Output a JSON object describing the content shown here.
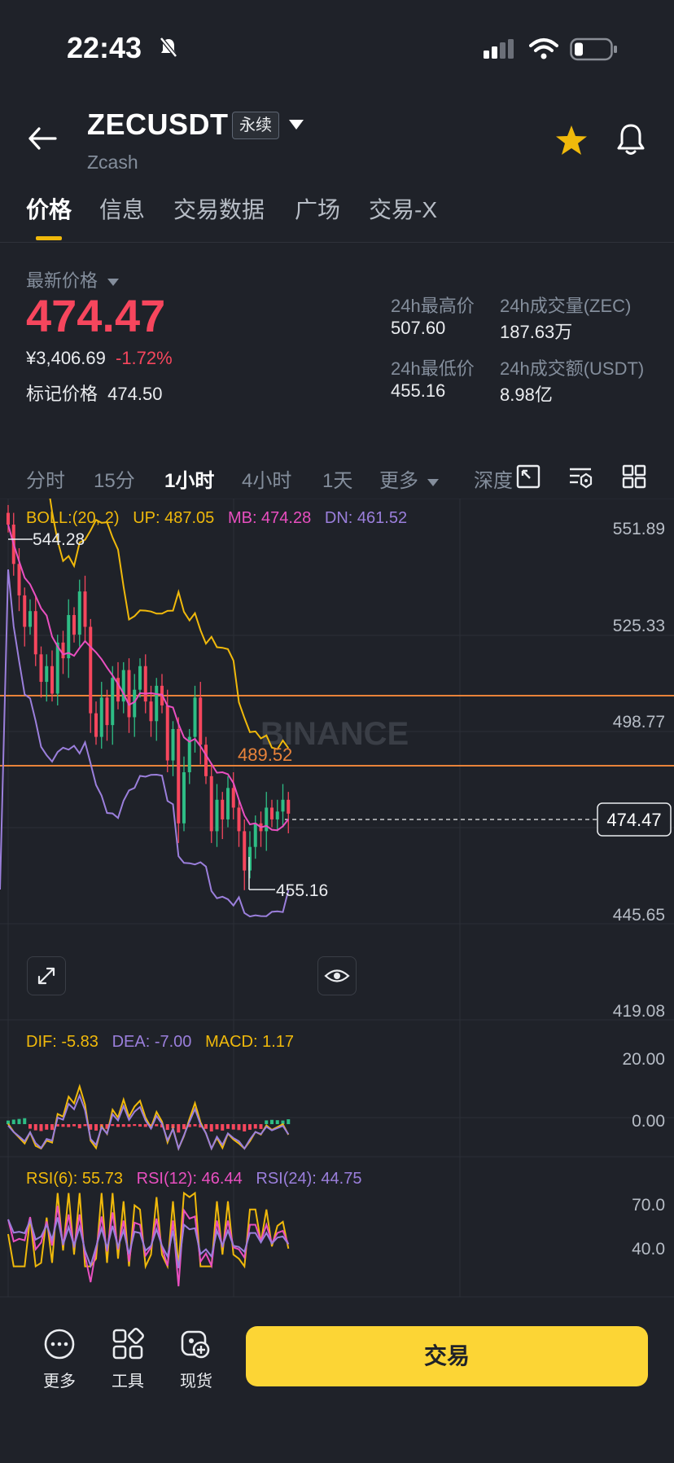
{
  "status_bar": {
    "time": "22:43"
  },
  "header": {
    "symbol": "ZECUSDT",
    "contract_type": "永续",
    "coin_name": "Zcash"
  },
  "tabs": [
    "价格",
    "信息",
    "交易数据",
    "广场",
    "交易-X"
  ],
  "price": {
    "latest_label": "最新价格",
    "last": "474.47",
    "cny": "¥3,406.69",
    "change": "-1.72%",
    "mark_label": "标记价格",
    "mark_value": "474.50",
    "stats": [
      {
        "label": "24h最高价",
        "value": "507.60"
      },
      {
        "label": "24h成交量(ZEC)",
        "value": "187.63万"
      },
      {
        "label": "24h最低价",
        "value": "455.16"
      },
      {
        "label": "24h成交额(USDT)",
        "value": "8.98亿"
      }
    ]
  },
  "intervals": {
    "items": [
      "分时",
      "15分",
      "1小时",
      "4小时",
      "1天",
      "更多",
      "深度"
    ],
    "active": "1小时"
  },
  "chart_data": {
    "type": "candlestick",
    "y_axis_ticks": [
      "551.89",
      "525.33",
      "498.77",
      "445.65",
      "419.08"
    ],
    "current_price_label": "474.47",
    "high_marker": "544.28",
    "low_marker": "455.16",
    "price_line_label": "489.52",
    "watermark": "BINANCE",
    "boll": {
      "label": "BOLL:(20, 2)",
      "up": "UP: 487.05",
      "mb": "MB: 474.28",
      "dn": "DN: 461.52"
    },
    "macd": {
      "dif": "DIF: -5.83",
      "dea": "DEA: -7.00",
      "macd": "MACD: 1.17",
      "ticks": [
        "20.00",
        "0.00"
      ]
    },
    "rsi": {
      "rsi6": "RSI(6): 55.73",
      "rsi12": "RSI(12): 46.44",
      "rsi24": "RSI(24): 44.75",
      "ticks": [
        "70.0",
        "40.0"
      ]
    },
    "closes": [
      548,
      538,
      530,
      522,
      526,
      515,
      508,
      512,
      505,
      518,
      514,
      525,
      520,
      531,
      522,
      500,
      494,
      504,
      497,
      509,
      503,
      511,
      499,
      506,
      512,
      503,
      498,
      507,
      502,
      488,
      496,
      472,
      485,
      494,
      504,
      492,
      484,
      470,
      478,
      473,
      481,
      476,
      470,
      460,
      466,
      472,
      470,
      476,
      473,
      475,
      478,
      474.47
    ]
  },
  "colors": {
    "up": "#2ebd85",
    "down": "#f6465d",
    "accent": "#f0b90b",
    "boll_up": "#f0b90b",
    "boll_mb": "#e94fc0",
    "boll_dn": "#9b7fdc"
  },
  "bottom": {
    "more": "更多",
    "tools": "工具",
    "spot": "现货",
    "trade": "交易"
  }
}
